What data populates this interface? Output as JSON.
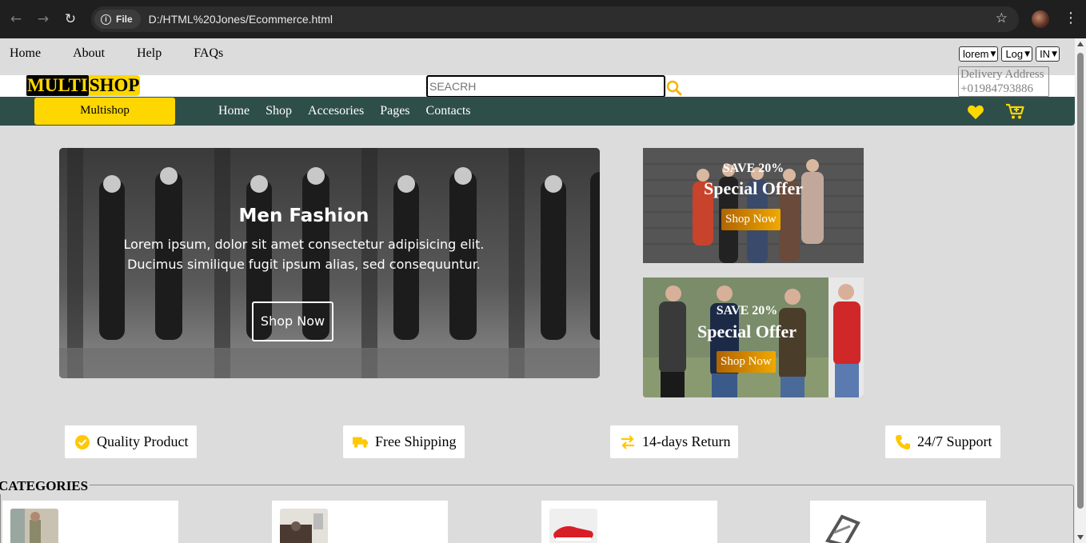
{
  "browser": {
    "chip_label": "File",
    "url": "D:/HTML%20Jones/Ecommerce.html"
  },
  "topnav": [
    "Home",
    "About",
    "Help",
    "FAQs"
  ],
  "selects": [
    "lorem",
    "Log",
    "IN"
  ],
  "logo": {
    "part1": "MULTI",
    "part2": "SHOP"
  },
  "search": {
    "placeholder": "SEACRH"
  },
  "delivery": {
    "line1": "Delivery Address",
    "line2": "+01984793886"
  },
  "brand_button": "Multishop",
  "mainnav": [
    "Home",
    "Shop",
    "Accesories",
    "Pages",
    "Contacts"
  ],
  "hero": {
    "title": "Men Fashion",
    "line1": "Lorem ipsum, dolor sit amet consectetur adipisicing elit.",
    "line2": "Ducimus similique fugit ipsum alias, sed consequuntur.",
    "button": "Shop Now"
  },
  "offers": [
    {
      "save": "SAVE 20%",
      "title": "Special Offer",
      "button": "Shop Now"
    },
    {
      "save": "SAVE 20%",
      "title": "Special Offer",
      "button": "Shop Now"
    }
  ],
  "features": [
    "Quality Product",
    "Free Shipping",
    "14-days Return",
    "24/7 Support"
  ],
  "categories": {
    "legend": "CATEGORIES"
  },
  "colors": {
    "accent": "#ffd700",
    "navbar": "#2e4e4a"
  }
}
